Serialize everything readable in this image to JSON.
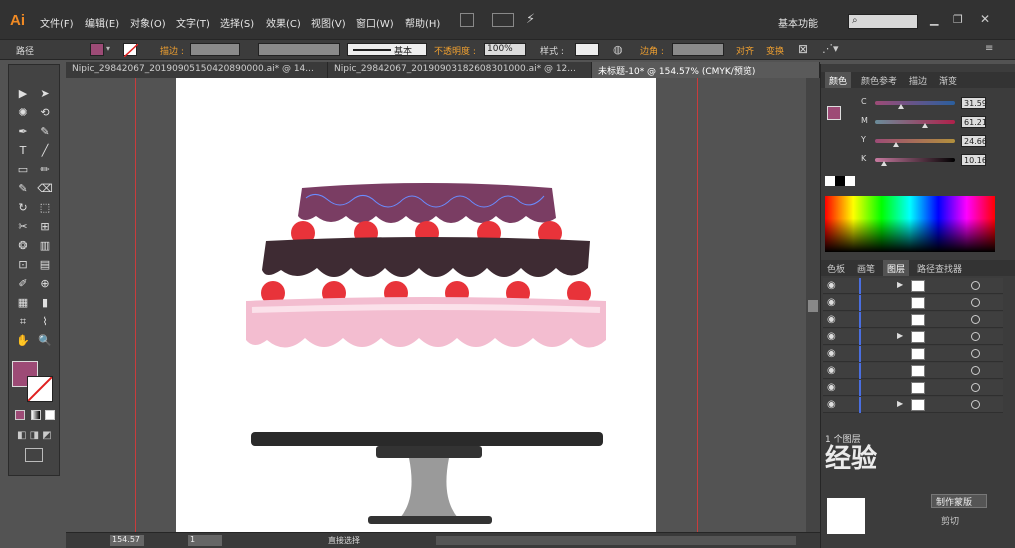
{
  "app": {
    "logo": "Ai"
  },
  "menu": [
    "文件(F)",
    "编辑(E)",
    "对象(O)",
    "文字(T)",
    "选择(S)",
    "效果(C)",
    "视图(V)",
    "窗口(W)",
    "帮助(H)"
  ],
  "workspace": "基本功能",
  "control": {
    "object_type": "路径",
    "stroke_label": "描边 :",
    "brush": "基本",
    "opacity_label": "不透明度 :",
    "opacity": "100%",
    "style_label": "样式 :",
    "corner_label": "边角 :",
    "align": "对齐",
    "transform": "变换"
  },
  "tabs": [
    "Nipic_29842067_20190905150420890000.ai* @ 14...",
    "Nipic_29842067_20190903182608301000.ai* @ 12...",
    "未标题-10* @ 154.57% (CMYK/预览)"
  ],
  "tools": [
    "▶",
    "➤",
    "✺",
    "⟲",
    "✒",
    "✎",
    "T",
    "╱",
    "▭",
    "✏",
    "✎",
    "⌫",
    "↻",
    "⬚",
    "✂",
    "⊞",
    "❂",
    "▥",
    "⊡",
    "▤",
    "✐",
    "⊕",
    "▦",
    "▮",
    "⌗",
    "⌇",
    "✋",
    "🔍"
  ],
  "color_panel": {
    "tabs": [
      "颜色",
      "颜色参考",
      "描边",
      "渐变"
    ],
    "channels": [
      {
        "name": "C",
        "value": "31.59",
        "frac": 0.3159
      },
      {
        "name": "M",
        "value": "61.21",
        "frac": 0.6121
      },
      {
        "name": "Y",
        "value": "24.66",
        "frac": 0.2466
      },
      {
        "name": "K",
        "value": "10.16",
        "frac": 0.1016
      }
    ]
  },
  "layers_panel": {
    "tabs": [
      "色板",
      "画笔",
      "图层",
      "路径查找器"
    ],
    "count_label": "1 个图层",
    "expand_flags": [
      true,
      false,
      false,
      true,
      false,
      false,
      false,
      true
    ]
  },
  "lower_panel": {
    "make_mask": "制作蒙版",
    "clip": "剪切"
  },
  "status": {
    "zoom": "154.57",
    "page": "1",
    "tool": "直接选择"
  },
  "watermark": "经验",
  "colors": {
    "fill": "#9d4b76",
    "purple": "#7a3d63",
    "dark": "#3e2b33",
    "pink": "#f3bdd0",
    "cherry": "#e8333a"
  }
}
